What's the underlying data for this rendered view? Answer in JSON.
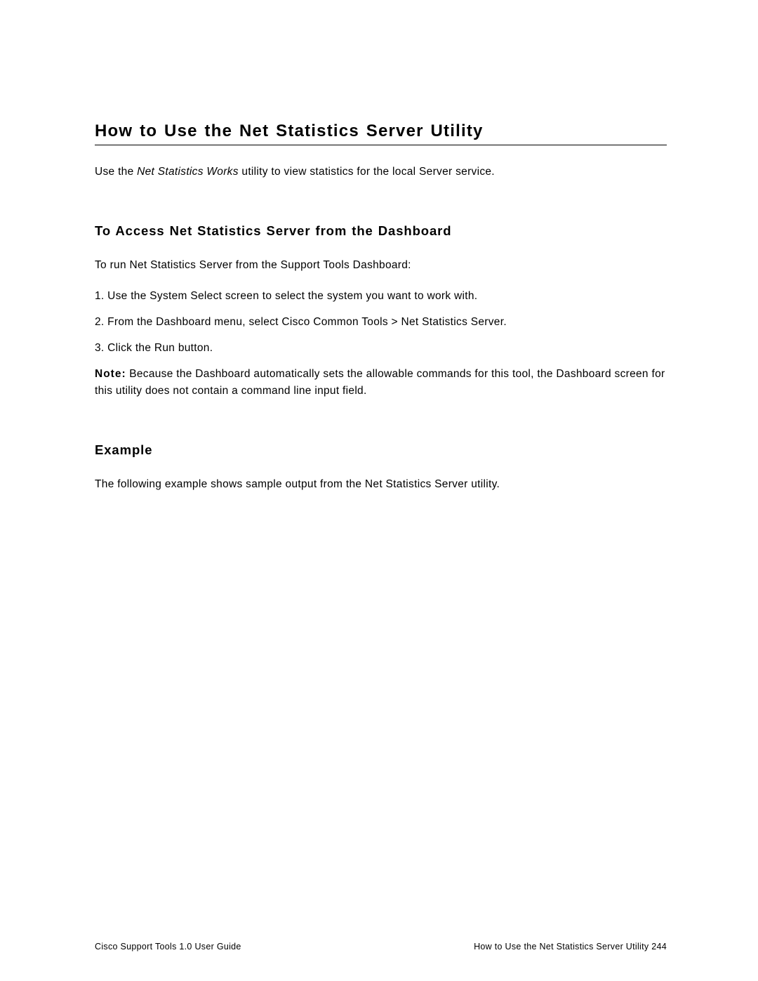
{
  "title": "How to Use the Net Statistics Server Utility",
  "intro_prefix": "Use the ",
  "intro_italic": "Net Statistics Works",
  "intro_suffix": " utility to view statistics for the local Server service.",
  "section1": {
    "heading": "To Access Net Statistics Server from the Dashboard",
    "lead": "To run Net Statistics Server from the Support Tools Dashboard:",
    "steps": {
      "s1": "1.  Use the System Select screen to select the system you want to work with.",
      "s2": "2.  From the Dashboard menu, select Cisco Common Tools > Net Statistics Server.",
      "s3": "3.  Click the Run button."
    },
    "note_label": "Note:",
    "note_text": " Because the Dashboard automatically sets the allowable commands for this tool, the Dashboard screen for this utility does not contain a command line input field."
  },
  "section2": {
    "heading": "Example",
    "body": "The following example shows sample output from the Net Statistics Server utility."
  },
  "footer": {
    "left": "Cisco Support Tools 1.0 User Guide",
    "right": "How to Use the Net Statistics Server Utility   244"
  }
}
